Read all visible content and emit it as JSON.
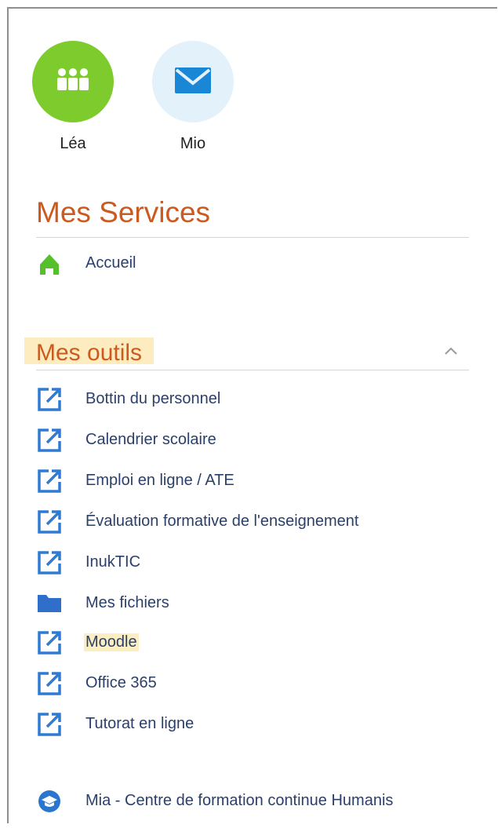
{
  "apps": [
    {
      "label": "Léa",
      "icon": "people-icon",
      "color": "#7ecb2e"
    },
    {
      "label": "Mio",
      "icon": "envelope-icon",
      "color": "#e3f1fb"
    }
  ],
  "services": {
    "title": "Mes Services",
    "items": [
      {
        "label": "Accueil",
        "icon": "home-icon"
      }
    ]
  },
  "outils": {
    "title": "Mes outils",
    "collapse_icon": "chevron-up-icon",
    "items": [
      {
        "label": "Bottin du personnel",
        "icon": "external-link-icon"
      },
      {
        "label": "Calendrier scolaire",
        "icon": "external-link-icon"
      },
      {
        "label": "Emploi en ligne / ATE",
        "icon": "external-link-icon"
      },
      {
        "label": "Évaluation formative de l'enseignement",
        "icon": "external-link-icon"
      },
      {
        "label": "InukTIC",
        "icon": "external-link-icon"
      },
      {
        "label": "Mes fichiers",
        "icon": "folder-icon"
      },
      {
        "label": "Moodle",
        "icon": "external-link-icon"
      },
      {
        "label": "Office 365",
        "icon": "external-link-icon"
      },
      {
        "label": "Tutorat en ligne",
        "icon": "external-link-icon"
      }
    ]
  },
  "footer_item": {
    "label": "Mia - Centre de formation continue Humanis",
    "icon": "graduation-cap-icon"
  },
  "colors": {
    "accent": "#cc5a1e",
    "link": "#2a3f6a",
    "icon_blue": "#2f7bd3",
    "highlight": "#fbeec0"
  }
}
